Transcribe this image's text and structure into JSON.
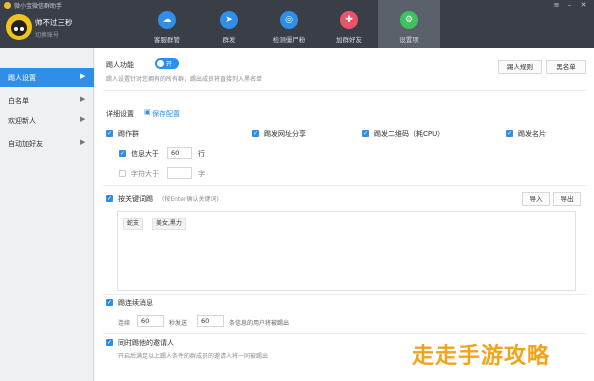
{
  "window": {
    "title": "微小宝微信群助手",
    "menu_icon": "hamburger-icon",
    "min_icon": "minimize-icon",
    "close_icon": "close-icon"
  },
  "user": {
    "name": "帅不过三秒",
    "switch": "切换账号"
  },
  "nav_tabs": [
    {
      "label": "客服群管",
      "color": "#2e8ee8",
      "icon": "chat-icon",
      "glyph": "☁"
    },
    {
      "label": "群发",
      "color": "#2e8ee8",
      "icon": "send-icon",
      "glyph": "➤"
    },
    {
      "label": "检测僵尸粉",
      "color": "#2e8ee8",
      "icon": "detect-icon",
      "glyph": "◎"
    },
    {
      "label": "加群好友",
      "color": "#e9546b",
      "icon": "add-friend-icon",
      "glyph": "✚"
    },
    {
      "label": "设置项",
      "color": "#3ec35e",
      "icon": "gear-icon",
      "glyph": "⚙",
      "active": true
    }
  ],
  "sidebar": {
    "items": [
      {
        "label": "踢人设置",
        "active": true
      },
      {
        "label": "白名单"
      },
      {
        "label": "欢迎新人"
      },
      {
        "label": "自动加好友"
      }
    ]
  },
  "kick": {
    "title": "踢人功能",
    "toggle": "开",
    "desc": "踢人设置针对您拥有的所有群，踢出成员将直接列入黑名单",
    "rules_btn": "踢人规则",
    "blacklist_btn": "黑名单"
  },
  "detail": {
    "title": "详细设置",
    "save": "保存配置",
    "ad_group": "踢作群",
    "url_share": "踢发网址分享",
    "qr_code": "踢发二维码（耗CPU）",
    "card": "踢发名片",
    "msg_gt_label": "信息大于",
    "msg_gt_value": "60",
    "msg_gt_unit": "行",
    "char_gt_label": "字符大于",
    "char_gt_value": "",
    "char_gt_unit": "字"
  },
  "keywords": {
    "label": "按关键词踢",
    "hint": "(按Enter确认关键词)",
    "import": "导入",
    "export": "导出",
    "tags": [
      "蛇支",
      "美女,黑力"
    ]
  },
  "consecutive": {
    "label": "踢连续消息",
    "prefix": "连续",
    "value1": "60",
    "middle": "秒发送",
    "value2": "60",
    "suffix": "条信息的用户将被踢出"
  },
  "inviter": {
    "label": "同时踢他的邀请人",
    "desc": "开启后满足以上踢人条件的群成员的邀请人将一同被踢出"
  },
  "watermark": "走走手游攻略"
}
